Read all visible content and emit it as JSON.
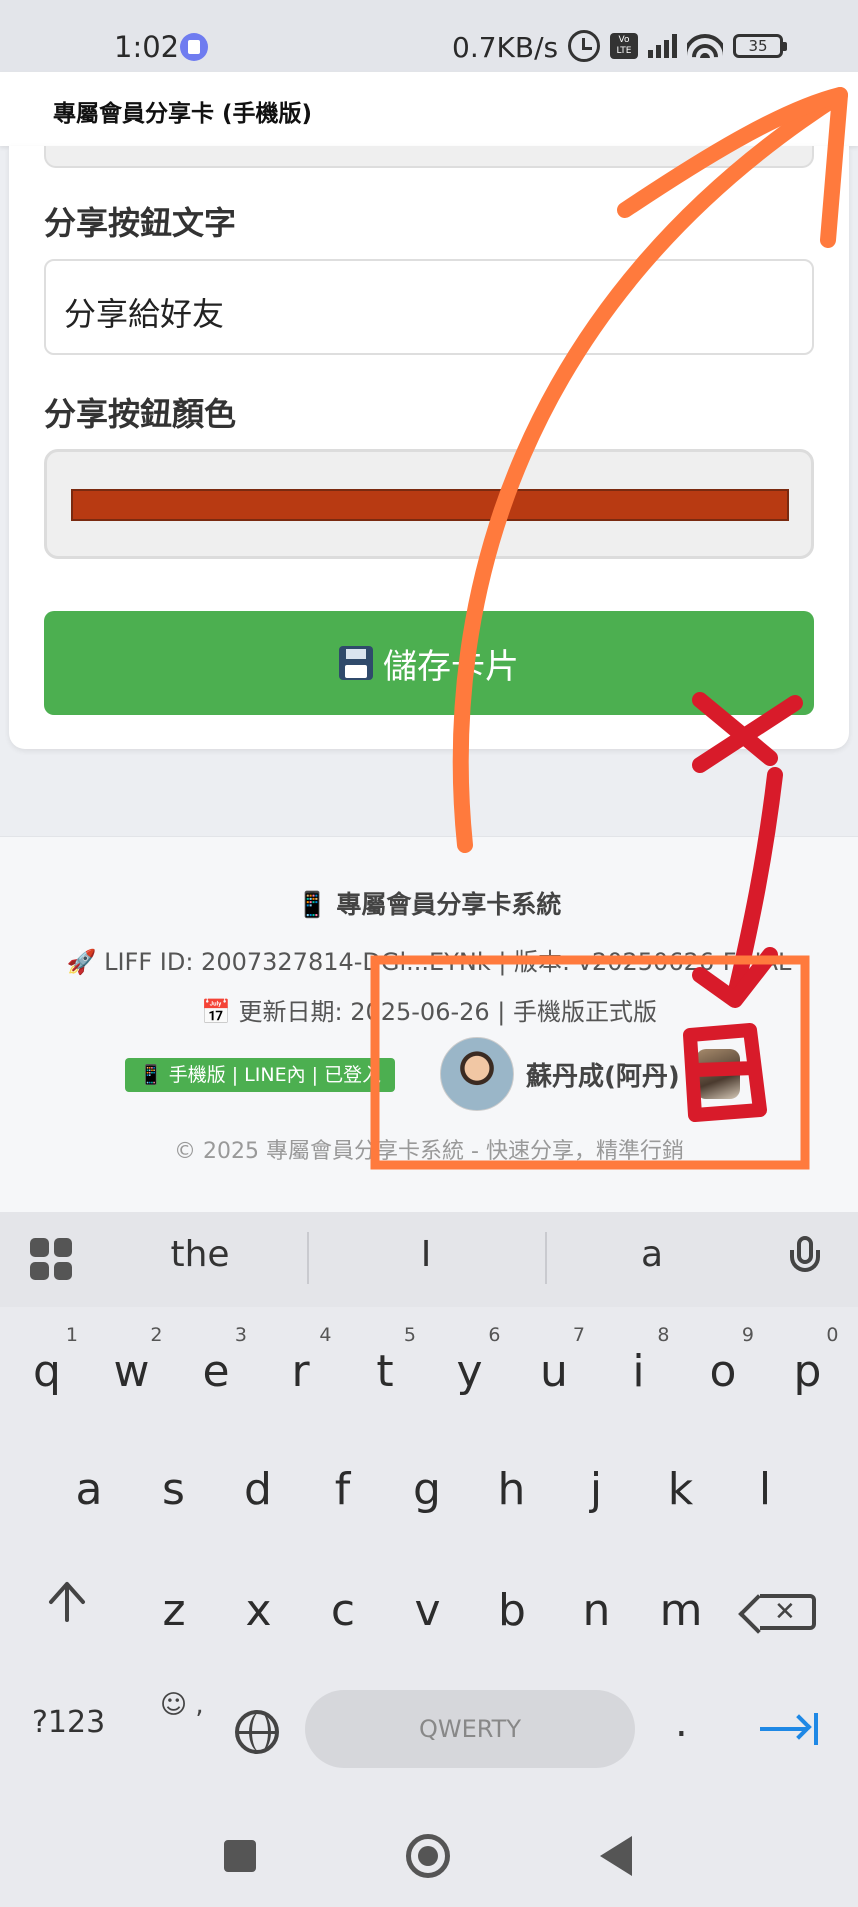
{
  "status_bar": {
    "time": "1:02",
    "speed": "0.7KB/s",
    "volte": "Vo LTE",
    "battery": "35"
  },
  "header": {
    "title": "專屬會員分享卡 (手機版)",
    "chevron": "›"
  },
  "form": {
    "share_button_text_label": "分享按鈕文字",
    "share_button_text_value": "分享給好友",
    "share_button_color_label": "分享按鈕顏色",
    "share_button_color": "#b83a12",
    "save_button_label": "儲存卡片"
  },
  "footer": {
    "system_title": "📱 專屬會員分享卡系統",
    "liff_line": "🚀 LIFF ID: 2007327814-DGl...EYNk | 版本: v20250626-FINAL",
    "update_line": "📅 更新日期: 2025-06-26 | 手機版正式版",
    "status_badge": "📱 手機版 | LINE內 | 已登入",
    "user_name": "蘇丹成(阿丹)",
    "copyright": "© 2025 專屬會員分享卡系統 - 快速分享，精準行銷"
  },
  "keyboard": {
    "suggestions": [
      "the",
      "I",
      "a"
    ],
    "row1": [
      {
        "key": "q",
        "num": "1"
      },
      {
        "key": "w",
        "num": "2"
      },
      {
        "key": "e",
        "num": "3"
      },
      {
        "key": "r",
        "num": "4"
      },
      {
        "key": "t",
        "num": "5"
      },
      {
        "key": "y",
        "num": "6"
      },
      {
        "key": "u",
        "num": "7"
      },
      {
        "key": "i",
        "num": "8"
      },
      {
        "key": "o",
        "num": "9"
      },
      {
        "key": "p",
        "num": "0"
      }
    ],
    "row2": [
      "a",
      "s",
      "d",
      "f",
      "g",
      "h",
      "j",
      "k",
      "l"
    ],
    "row3": [
      "z",
      "x",
      "c",
      "v",
      "b",
      "n",
      "m"
    ],
    "symbols_key": "?123",
    "emoji_key": "☺ ,",
    "space_label": "QWERTY",
    "period_key": "."
  },
  "annotation": {
    "mark": "回",
    "cross": "✕"
  },
  "colors": {
    "accent_green": "#4caf50",
    "annotation_orange": "#ff7a3d",
    "annotation_red": "#d81b2a"
  }
}
